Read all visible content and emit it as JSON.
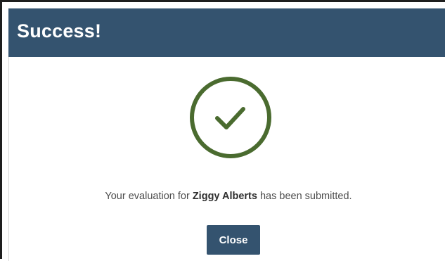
{
  "dialog": {
    "title": "Success!",
    "icon": "check-circle-icon",
    "message": {
      "prefix": "Your evaluation for ",
      "name": "Ziggy Alberts",
      "suffix": " has been submitted."
    },
    "close_label": "Close"
  },
  "colors": {
    "header": "#34536f",
    "success": "#4a6b2f",
    "button": "#34536f"
  }
}
